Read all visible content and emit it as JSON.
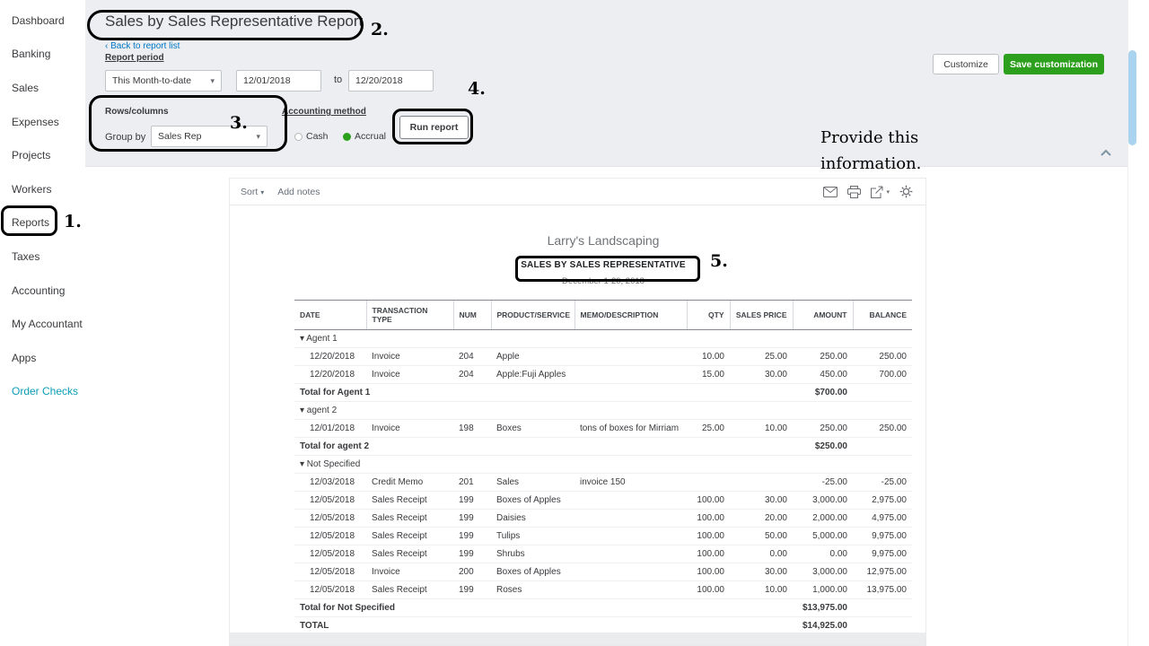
{
  "colors": {
    "accent_green": "#2ca01c",
    "link_blue": "#0077c5",
    "text_dark": "#393a3d",
    "header_bg": "#eceef1",
    "sidebar_accent_teal": "#0c9db5",
    "annotation_black": "#000000",
    "scrollbar_blue": "#a9d3ee"
  },
  "sidebar": {
    "items": [
      {
        "id": "dashboard",
        "label": "Dashboard"
      },
      {
        "id": "banking",
        "label": "Banking"
      },
      {
        "id": "sales",
        "label": "Sales"
      },
      {
        "id": "expenses",
        "label": "Expenses"
      },
      {
        "id": "projects",
        "label": "Projects"
      },
      {
        "id": "workers",
        "label": "Workers"
      },
      {
        "id": "reports",
        "label": "Reports"
      },
      {
        "id": "taxes",
        "label": "Taxes"
      },
      {
        "id": "accounting",
        "label": "Accounting"
      },
      {
        "id": "my-accountant",
        "label": "My Accountant"
      },
      {
        "id": "apps",
        "label": "Apps"
      },
      {
        "id": "order-checks",
        "label": "Order Checks",
        "accent": true
      }
    ]
  },
  "header": {
    "title": "Sales by Sales Representative Report",
    "back_link": "Back to report list",
    "report_period_label": "Report period",
    "period_value": "This Month-to-date",
    "date_from": "12/01/2018",
    "to_label": "to",
    "date_to": "12/20/2018",
    "customize_label": "Customize",
    "save_customization_label": "Save customization",
    "rows_columns_label": "Rows/columns",
    "group_by_label": "Group by",
    "group_by_value": "Sales Rep",
    "accounting_method_label": "Accounting method",
    "cash_label": "Cash",
    "accrual_label": "Accrual",
    "run_report_label": "Run report"
  },
  "toolbar": {
    "sort_label": "Sort",
    "add_notes_label": "Add notes"
  },
  "report": {
    "company": "Larry's Landscaping",
    "title": "SALES BY SALES REPRESENTATIVE",
    "period": "December 1-20, 2018",
    "columns": [
      "DATE",
      "TRANSACTION TYPE",
      "NUM",
      "PRODUCT/SERVICE",
      "MEMO/DESCRIPTION",
      "QTY",
      "SALES PRICE",
      "AMOUNT",
      "BALANCE"
    ],
    "groups": [
      {
        "name": "Agent 1",
        "rows": [
          [
            "12/20/2018",
            "Invoice",
            "204",
            "Apple",
            "",
            "10.00",
            "25.00",
            "250.00",
            "250.00"
          ],
          [
            "12/20/2018",
            "Invoice",
            "204",
            "Apple:Fuji Apples",
            "",
            "15.00",
            "30.00",
            "450.00",
            "700.00"
          ]
        ],
        "total_label": "Total for Agent 1",
        "total_amount": "$700.00"
      },
      {
        "name": "agent 2",
        "rows": [
          [
            "12/01/2018",
            "Invoice",
            "198",
            "Boxes",
            "tons of boxes for Mirriam",
            "25.00",
            "10.00",
            "250.00",
            "250.00"
          ]
        ],
        "total_label": "Total for agent 2",
        "total_amount": "$250.00"
      },
      {
        "name": "Not Specified",
        "rows": [
          [
            "12/03/2018",
            "Credit Memo",
            "201",
            "Sales",
            "invoice 150",
            "",
            "",
            "-25.00",
            "-25.00"
          ],
          [
            "12/05/2018",
            "Sales Receipt",
            "199",
            "Boxes of Apples",
            "",
            "100.00",
            "30.00",
            "3,000.00",
            "2,975.00"
          ],
          [
            "12/05/2018",
            "Sales Receipt",
            "199",
            "Daisies",
            "",
            "100.00",
            "20.00",
            "2,000.00",
            "4,975.00"
          ],
          [
            "12/05/2018",
            "Sales Receipt",
            "199",
            "Tulips",
            "",
            "100.00",
            "50.00",
            "5,000.00",
            "9,975.00"
          ],
          [
            "12/05/2018",
            "Sales Receipt",
            "199",
            "Shrubs",
            "",
            "100.00",
            "0.00",
            "0.00",
            "9,975.00"
          ],
          [
            "12/05/2018",
            "Invoice",
            "200",
            "Boxes of Apples",
            "",
            "100.00",
            "30.00",
            "3,000.00",
            "12,975.00"
          ],
          [
            "12/05/2018",
            "Sales Receipt",
            "199",
            "Roses",
            "",
            "100.00",
            "10.00",
            "1,000.00",
            "13,975.00"
          ]
        ],
        "total_label": "Total for Not Specified",
        "total_amount": "$13,975.00"
      }
    ],
    "grand_total_label": "TOTAL",
    "grand_total_amount": "$14,925.00"
  },
  "annotations": {
    "step1": "1.",
    "step2": "2.",
    "step3": "3.",
    "step4": "4.",
    "step5": "5.",
    "note_line1": "Provide this",
    "note_line2": "information."
  }
}
